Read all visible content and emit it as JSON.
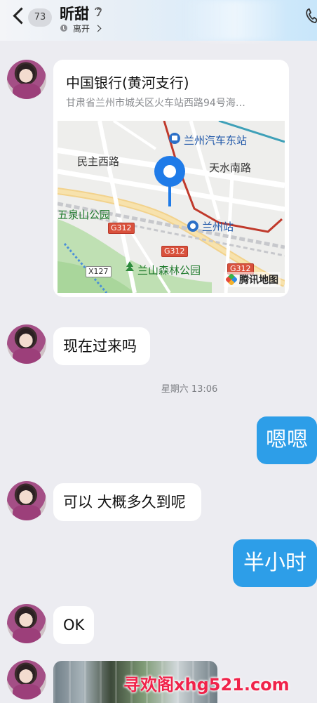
{
  "header": {
    "unread_count": "73",
    "contact_name": "昕甜",
    "status": "离开"
  },
  "messages": [
    {
      "type": "location",
      "direction": "in",
      "title": "中国银行(黄河支行)",
      "address": "甘肃省兰州市城关区火车站西路94号海…",
      "map": {
        "labels": [
          "兰州汽车东站",
          "民主西路",
          "天水南路",
          "五泉山公园",
          "兰州站",
          "兰山森林公园"
        ],
        "road_badges": [
          "G312",
          "G312",
          "G312",
          "X127"
        ],
        "provider": "腾讯地图"
      }
    },
    {
      "type": "text",
      "direction": "in",
      "text": "现在过来吗"
    },
    {
      "type": "timestamp",
      "text": "星期六 13:06"
    },
    {
      "type": "text",
      "direction": "out",
      "text": "嗯嗯"
    },
    {
      "type": "text",
      "direction": "in",
      "text": "可以 大概多久到呢"
    },
    {
      "type": "text",
      "direction": "out",
      "text": "半小时"
    },
    {
      "type": "text",
      "direction": "in",
      "text": "OK"
    },
    {
      "type": "image",
      "direction": "in"
    }
  ],
  "watermark": "寻欢阁xhg521.com",
  "colors": {
    "outgoing_bubble": "#2d9ee8",
    "incoming_bubble": "#ffffff",
    "background": "#ececf1",
    "watermark": "#f0234a"
  }
}
